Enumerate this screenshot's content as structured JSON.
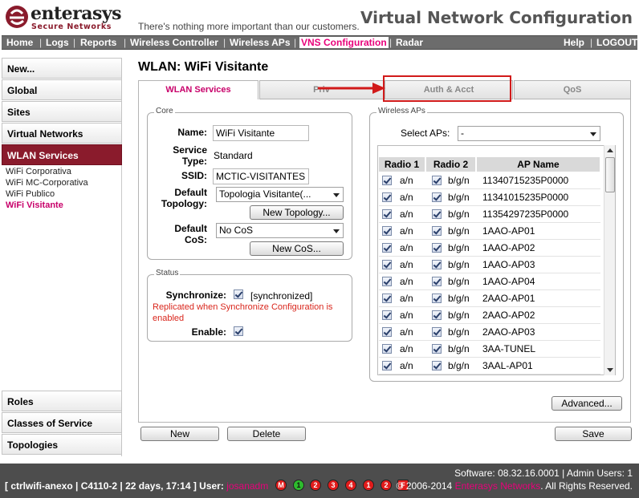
{
  "header": {
    "brand": "enterasys",
    "brand_sub": "Secure Networks",
    "tagline": "There's nothing more important than our customers.",
    "app_title": "Virtual Network Configuration"
  },
  "topnav": {
    "left": [
      "Home",
      "Logs",
      "Reports",
      "Wireless Controller",
      "Wireless APs",
      "VNS Configuration",
      "Radar"
    ],
    "active": "VNS Configuration",
    "right": [
      "Help",
      "LOGOUT"
    ]
  },
  "sidebar": {
    "top_items": [
      "New...",
      "Global",
      "Sites",
      "Virtual Networks",
      "WLAN Services"
    ],
    "selected": "WLAN Services",
    "sub_items": [
      "WiFi Corporativa",
      "WiFi MC-Corporativa",
      "WiFi Publico",
      "WiFi Visitante"
    ],
    "current_sub": "WiFi Visitante",
    "bottom_items": [
      "Roles",
      "Classes of Service",
      "Topologies"
    ]
  },
  "page_title": "WLAN: WiFi Visitante",
  "tabs": [
    "WLAN Services",
    "Priv",
    "Auth & Acct",
    "QoS"
  ],
  "active_tab": "WLAN Services",
  "core": {
    "legend": "Core",
    "name_label": "Name:",
    "name_value": "WiFi Visitante",
    "service_type_label_1": "Service",
    "service_type_label_2": "Type:",
    "service_type_value": "Standard",
    "ssid_label": "SSID:",
    "ssid_value": "MCTIC-VISITANTES",
    "topology_label_1": "Default",
    "topology_label_2": "Topology:",
    "topology_value": "Topologia Visitante(...",
    "new_topology_button": "New Topology...",
    "cos_label_1": "Default",
    "cos_label_2": "CoS:",
    "cos_value": "No CoS",
    "new_cos_button": "New CoS..."
  },
  "status": {
    "legend": "Status",
    "synchronize_label": "Synchronize:",
    "synchronize_checked": true,
    "synchronize_state": "[synchronized]",
    "warning_line1": "Replicated when Synchronize Configuration is",
    "warning_line2": "enabled",
    "enable_label": "Enable:",
    "enable_checked": true
  },
  "wireless_aps": {
    "legend": "Wireless APs",
    "select_label": "Select APs:",
    "select_value": "-",
    "columns": [
      "Radio 1",
      "Radio 2",
      "AP Name"
    ],
    "rows": [
      {
        "r1": "a/n",
        "r2": "b/g/n",
        "name": "11340715235P0000"
      },
      {
        "r1": "a/n",
        "r2": "b/g/n",
        "name": "11341015235P0000"
      },
      {
        "r1": "a/n",
        "r2": "b/g/n",
        "name": "11354297235P0000"
      },
      {
        "r1": "a/n",
        "r2": "b/g/n",
        "name": "1AAO-AP01"
      },
      {
        "r1": "a/n",
        "r2": "b/g/n",
        "name": "1AAO-AP02"
      },
      {
        "r1": "a/n",
        "r2": "b/g/n",
        "name": "1AAO-AP03"
      },
      {
        "r1": "a/n",
        "r2": "b/g/n",
        "name": "1AAO-AP04"
      },
      {
        "r1": "a/n",
        "r2": "b/g/n",
        "name": "2AAO-AP01"
      },
      {
        "r1": "a/n",
        "r2": "b/g/n",
        "name": "2AAO-AP02"
      },
      {
        "r1": "a/n",
        "r2": "b/g/n",
        "name": "2AAO-AP03"
      },
      {
        "r1": "a/n",
        "r2": "b/g/n",
        "name": "3AA-TUNEL"
      },
      {
        "r1": "a/n",
        "r2": "b/g/n",
        "name": "3AAL-AP01"
      }
    ]
  },
  "advanced_button": "Advanced...",
  "actions": {
    "new": "New",
    "delete": "Delete",
    "save": "Save"
  },
  "footer": {
    "software": "Software: 08.32.16.0001 | Admin Users: 1",
    "status_prefix": "[ ctrlwifi-anexo | C4110-2 | 22 days, 17:14 ] User:",
    "user": "josanadm",
    "badges": [
      "M",
      "1",
      "2",
      "3",
      "4",
      "1",
      "2",
      "F"
    ],
    "copyright_prefix": "© 2006-2014",
    "copyright_company": "Enterasys Networks",
    "copyright_suffix": ". All Rights Reserved."
  },
  "colors": {
    "accent": "#e8007a",
    "brand": "#8a1b2c",
    "callout": "#d11a1a"
  }
}
